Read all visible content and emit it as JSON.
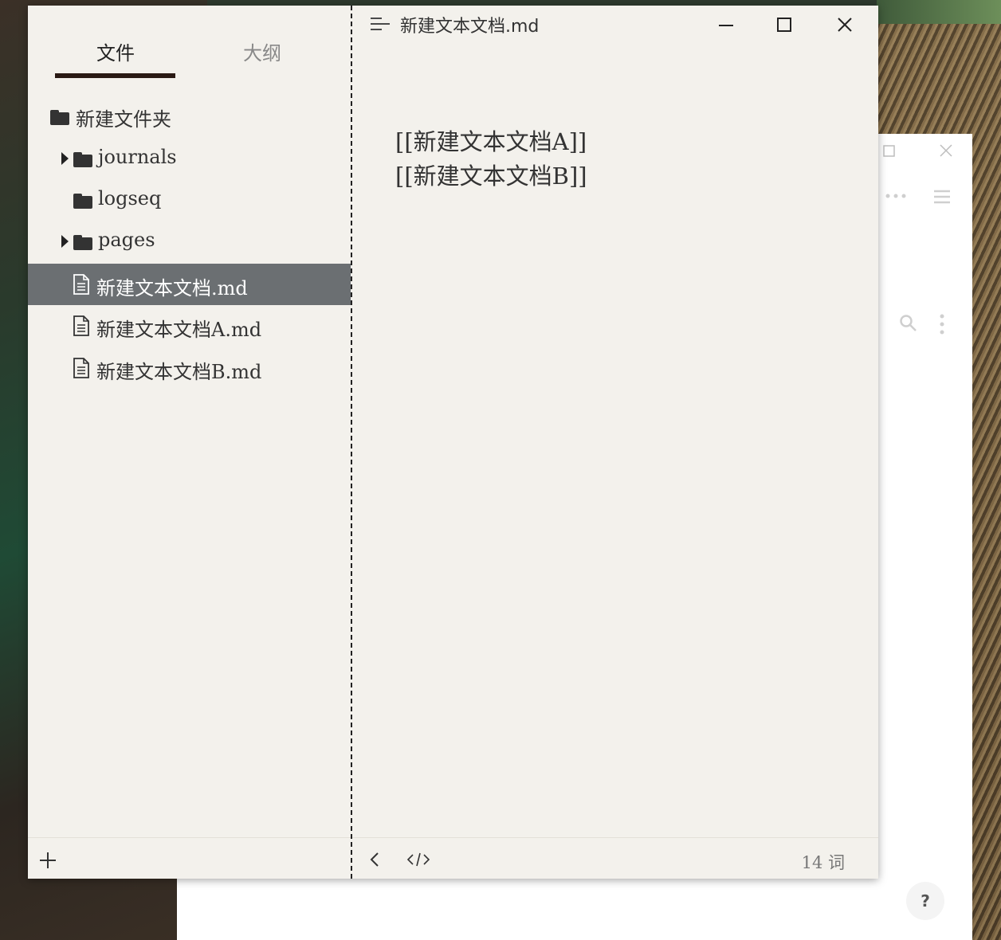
{
  "sidebar": {
    "tabs": [
      {
        "label": "文件",
        "active": true
      },
      {
        "label": "大纲",
        "active": false
      }
    ],
    "tree": [
      {
        "type": "folder",
        "label": "新建文件夹",
        "expandable": false,
        "level": 0
      },
      {
        "type": "folder",
        "label": "journals",
        "expandable": true,
        "level": 1
      },
      {
        "type": "folder",
        "label": "logseq",
        "expandable": false,
        "level": 1
      },
      {
        "type": "folder",
        "label": "pages",
        "expandable": true,
        "level": 1
      },
      {
        "type": "file",
        "label": "新建文本文档.md",
        "active": true,
        "level": 1
      },
      {
        "type": "file",
        "label": "新建文本文档A.md",
        "active": false,
        "level": 1
      },
      {
        "type": "file",
        "label": "新建文本文档B.md",
        "active": false,
        "level": 1
      }
    ],
    "add_icon": "plus-icon"
  },
  "editor": {
    "title": "新建文本文档.md",
    "lines": [
      "[[新建文本文档A]]",
      "[[新建文本文档B]]"
    ],
    "word_count": "14 词"
  },
  "background_window": {
    "help_label": "?"
  },
  "colors": {
    "panel_bg": "#f3f1ec",
    "active_row": "#6b6f72",
    "tab_underline": "#2a1a14",
    "text": "#333333"
  }
}
